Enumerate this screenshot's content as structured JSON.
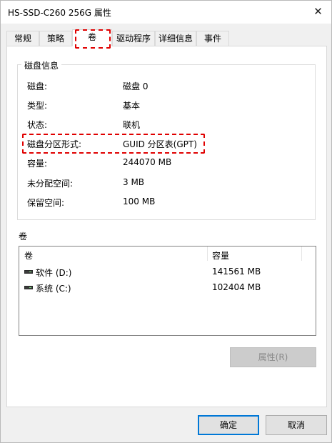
{
  "window": {
    "title": "HS-SSD-C260 256G 属性",
    "close_glyph": "✕"
  },
  "tabs": [
    {
      "label": "常规"
    },
    {
      "label": "策略"
    },
    {
      "label": "卷"
    },
    {
      "label": "驱动程序"
    },
    {
      "label": "详细信息"
    },
    {
      "label": "事件"
    }
  ],
  "active_tab": "卷",
  "disk_info": {
    "group_title": "磁盘信息",
    "rows": [
      {
        "label": "磁盘:",
        "value": "磁盘 0"
      },
      {
        "label": "类型:",
        "value": "基本"
      },
      {
        "label": "状态:",
        "value": "联机"
      },
      {
        "label": "磁盘分区形式:",
        "value": "GUID 分区表(GPT)"
      },
      {
        "label": "容量:",
        "value": "244070 MB"
      },
      {
        "label": "未分配空间:",
        "value": "3 MB"
      },
      {
        "label": "保留空间:",
        "value": "100 MB"
      }
    ]
  },
  "volumes": {
    "section_title": "卷",
    "columns": [
      "卷",
      "容量"
    ],
    "rows": [
      {
        "name": "软件 (D:)",
        "capacity": "141561 MB",
        "icon": "drive-icon"
      },
      {
        "name": "系统 (C:)",
        "capacity": "102404 MB",
        "icon": "drive-icon"
      }
    ],
    "properties_button": "属性(R)"
  },
  "footer": {
    "ok_label": "确定",
    "cancel_label": "取消"
  },
  "colors": {
    "highlight": "#e00000",
    "accent": "#0078d7"
  }
}
